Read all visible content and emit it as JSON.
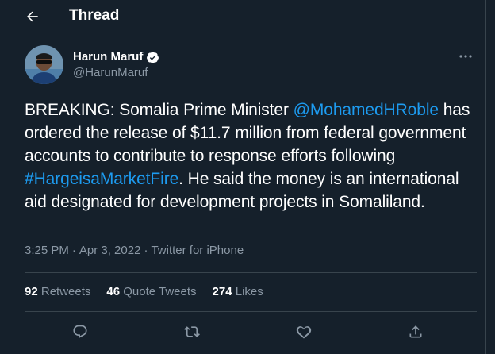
{
  "header": {
    "title": "Thread",
    "back_icon": "arrow-left-icon"
  },
  "tweet": {
    "author": {
      "name": "Harun Maruf",
      "handle": "@HarunMaruf",
      "verified": true
    },
    "text": {
      "p1": "BREAKING: Somalia Prime Minister ",
      "mention": "@MohamedHRoble",
      "p2": " has ordered the release of $11.7 million from federal government accounts to contribute to response efforts following ",
      "hashtag": "#HargeisaMarketFire",
      "p3": ". He said the money is an international aid designated for development projects in Somaliland."
    },
    "time": "3:25 PM",
    "date": "Apr 3, 2022",
    "source": "Twitter for iPhone",
    "stats": {
      "retweets_count": "92",
      "retweets_label": "Retweets",
      "quotes_count": "46",
      "quotes_label": "Quote Tweets",
      "likes_count": "274",
      "likes_label": "Likes"
    },
    "actions": [
      "reply-icon",
      "retweet-icon",
      "like-icon",
      "share-icon"
    ]
  },
  "colors": {
    "background": "#15202b",
    "text": "#ffffff",
    "muted": "#8b98a5",
    "link": "#1d9bf0",
    "border": "#38444d"
  }
}
